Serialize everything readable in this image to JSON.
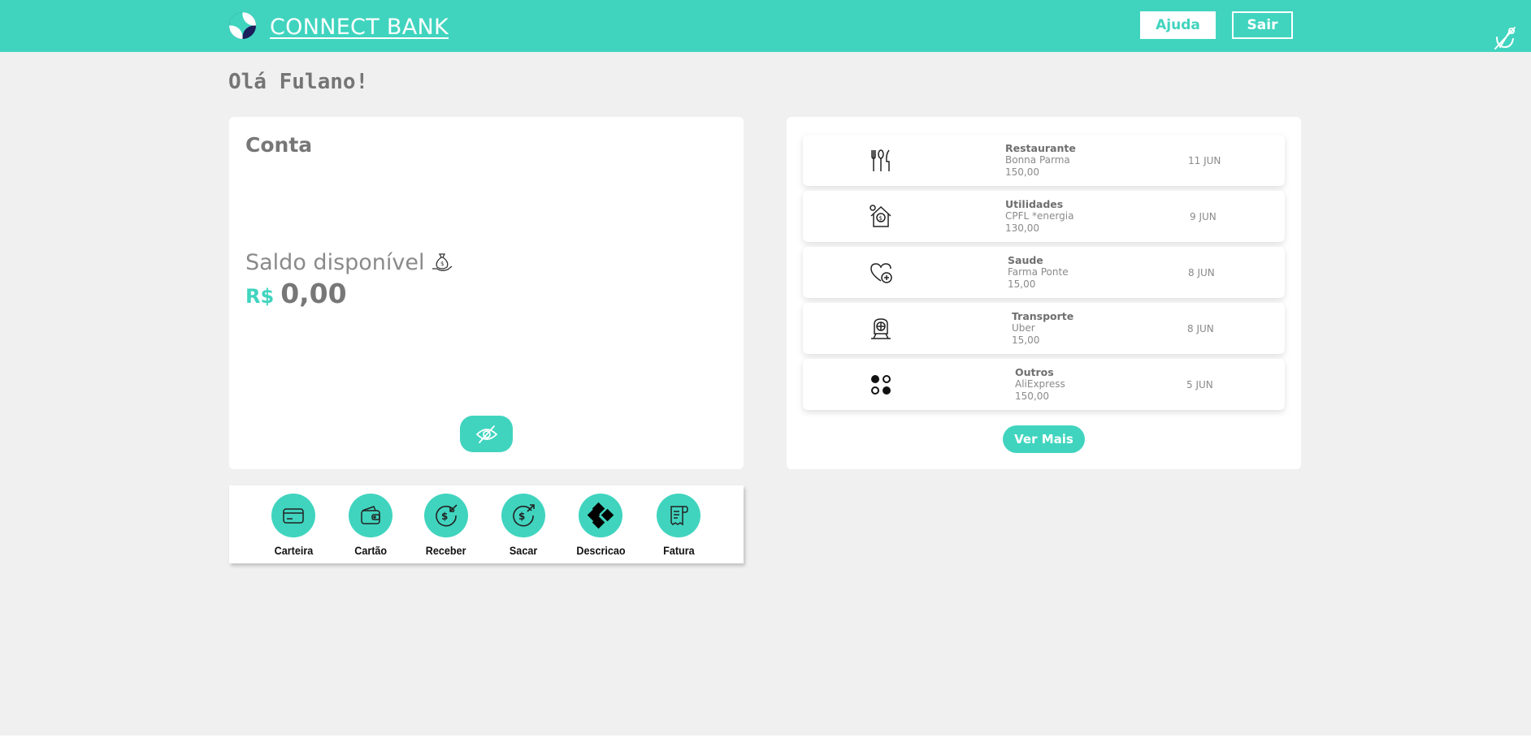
{
  "colors": {
    "accent": "#40d4bf",
    "background": "#f0f0f0",
    "card": "#ffffff",
    "text": "#777777"
  },
  "header": {
    "brand": "CONNECT BANK",
    "help_label": "Ajuda",
    "exit_label": "Sair"
  },
  "greeting": "Olá Fulano!",
  "account": {
    "title": "Conta",
    "balance_label": "Saldo disponível",
    "currency": "R$",
    "balance": "0,00"
  },
  "actions": [
    {
      "label": "Carteira",
      "icon": "card-icon"
    },
    {
      "label": "Cartão",
      "icon": "wallet-icon"
    },
    {
      "label": "Receber",
      "icon": "receive-money-icon"
    },
    {
      "label": "Sacar",
      "icon": "withdraw-money-icon"
    },
    {
      "label": "Descricao",
      "icon": "pix-icon"
    },
    {
      "label": "Fatura",
      "icon": "receipt-icon"
    }
  ],
  "transactions": [
    {
      "category": "Restaurante",
      "merchant": "Bonna Parma",
      "amount": "150,00",
      "date": "11 JUN",
      "icon": "cutlery-icon"
    },
    {
      "category": "Utilidades",
      "merchant": "CPFL *energia",
      "amount": "130,00",
      "date": "9 JUN",
      "icon": "house-bill-icon"
    },
    {
      "category": "Saude",
      "merchant": "Farma Ponte",
      "amount": "15,00",
      "date": "8 JUN",
      "icon": "heart-health-icon"
    },
    {
      "category": "Transporte",
      "merchant": "Uber",
      "amount": "15,00",
      "date": "8 JUN",
      "icon": "train-icon"
    },
    {
      "category": "Outros",
      "merchant": "AliExpress",
      "amount": "150,00",
      "date": "5 JUN",
      "icon": "dots-grid-icon"
    }
  ],
  "see_more_label": "Ver Mais"
}
